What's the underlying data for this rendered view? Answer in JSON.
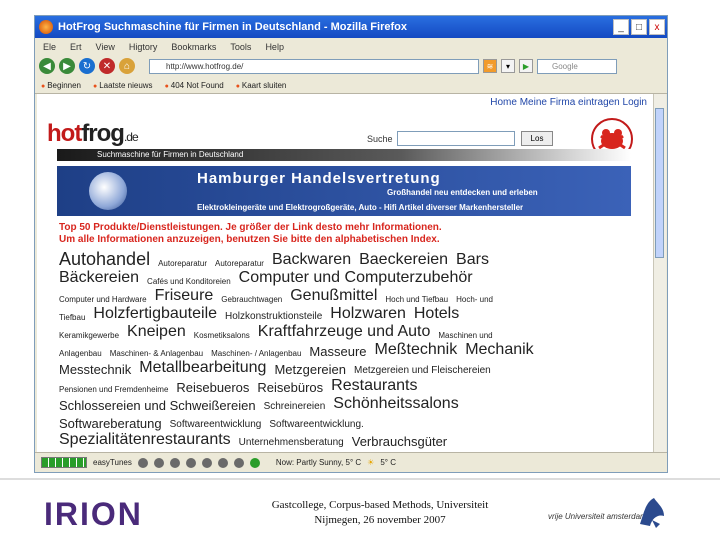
{
  "window": {
    "title": "HotFrog Suchmaschine für Firmen in Deutschland - Mozilla Firefox",
    "controls": [
      "_",
      "□",
      "x"
    ]
  },
  "menu": [
    "Ele",
    "Ert",
    "View",
    "Higtory",
    "Bookmarks",
    "Tools",
    "Help"
  ],
  "address": {
    "url": "http://www.hotfrog.de/"
  },
  "search_engine": {
    "placeholder": "Google"
  },
  "bookmarks": [
    "Beginnen",
    "Laatste nieuws",
    "404 Not Found",
    "Kaart sluiten"
  ],
  "page": {
    "topnav": "Home  Meine Firma eintragen  Login",
    "logo": {
      "brand_a": "hot",
      "brand_b": "frog",
      "tld": ".de"
    },
    "tagline": "Suchmaschine für Firmen in Deutschland",
    "search_label": "Suche",
    "search_button": "Los",
    "banner": {
      "headline": "Hamburger Handelsvertretung",
      "sub": "Großhandel neu entdecken und erleben",
      "line": "Elektrokleingeräte und Elektrogroßgeräte, Auto - Hifi Artikel diverser Markenhersteller"
    },
    "intro_1": "Top 50 Produkte/Dienstleistungen. Je größer der Link desto mehr Informationen.",
    "intro_2": "Um alle Informationen anzuzeigen, benutzen Sie bitte den alphabetischen Index.",
    "tags": [
      [
        "Autohandel",
        "Autoreparatur",
        "Autoreparatur",
        "Backwaren",
        "Baeckereien",
        "Bars"
      ],
      [
        "Bäckereien",
        "Cafés und Konditoreien",
        "Computer und Computerzubehör"
      ],
      [
        "Computer und Hardware",
        "Friseure",
        "Gebrauchtwagen",
        "Genußmittel",
        "Hoch und Tiefbau",
        "Hoch- und"
      ],
      [
        "Tiefbau",
        "Holzfertigbauteile",
        "Holzkonstruktionsteile",
        "Holzwaren",
        "Hotels"
      ],
      [
        "Keramikgewerbe",
        "Kneipen",
        "Kosmetiksalons",
        "Kraftfahrzeuge und Auto",
        "Maschinen und"
      ],
      [
        "Anlagenbau",
        "Maschinen- & Anlagenbau",
        "Maschinen- / Anlagenbau",
        "Masseure",
        "Meßtechnik",
        "Mechanik"
      ],
      [
        "Messtechnik",
        "Metallbearbeitung",
        "Metzgereien",
        "Metzgereien und Fleischereien"
      ],
      [
        "Pensionen und Fremdenheime",
        "Reisebueros",
        "Reisebüros",
        "Restaurants"
      ],
      [
        "Schlossereien und Schweißereien",
        "Schreinereien",
        "Schönheitssalons"
      ],
      [
        "Softwareberatung",
        "Softwareentwicklung",
        "Softwareentwicklung."
      ],
      [
        "Spezialitätenrestaurants",
        "Unternehmensberatung",
        "Verbrauchsgüter"
      ]
    ]
  },
  "status": {
    "addon": "easyTunes",
    "weather": "Now: Partly Sunny, 5° C",
    "temp": "5° C"
  },
  "slide": {
    "logo": "IRION",
    "caption_1": "Gastcollege, Corpus-based Methods, Universiteit",
    "caption_2": "Nijmegen, 26 november 2007",
    "vu_text": "vrije Universiteit  amsterdam"
  }
}
